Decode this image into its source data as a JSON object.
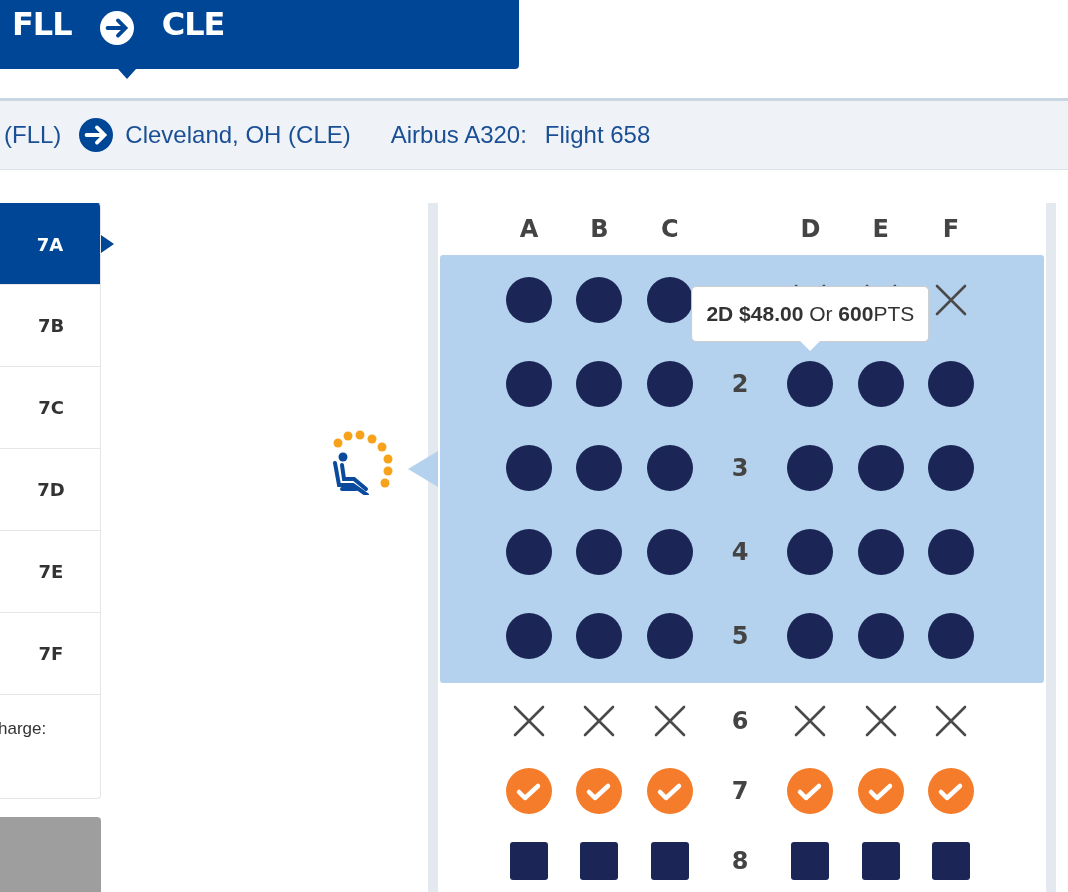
{
  "route_banner": {
    "origin": "FLL",
    "destination": "CLE"
  },
  "flight_bar": {
    "origin": "(FLL)",
    "destination": "Cleveland, OH (CLE)",
    "aircraft": "Airbus A320:",
    "flight": "Flight 658"
  },
  "seat_tabs": [
    {
      "label": "7A",
      "selected": true
    },
    {
      "label": "7B",
      "selected": false
    },
    {
      "label": "7C",
      "selected": false
    },
    {
      "label": "7D",
      "selected": false
    },
    {
      "label": "7E",
      "selected": false
    },
    {
      "label": "7F",
      "selected": false
    }
  ],
  "charge_note": "harge:",
  "seat_map": {
    "columns": [
      "A",
      "B",
      "C",
      "D",
      "E",
      "F"
    ],
    "zones": [
      {
        "kind": "highlighted",
        "rows": [
          {
            "seats": [
              {
                "kind": "available"
              },
              {
                "kind": "available"
              },
              {
                "kind": "available"
              },
              {
                "kind": "unavailable"
              },
              {
                "kind": "unavailable"
              },
              {
                "kind": "unavailable"
              }
            ]
          },
          {
            "number": "2",
            "seats": [
              {
                "kind": "available"
              },
              {
                "kind": "available"
              },
              {
                "kind": "available"
              },
              {
                "kind": "available",
                "tooltip": "**2D $48.00** Or **600**PTS"
              },
              {
                "kind": "available"
              },
              {
                "kind": "available"
              }
            ]
          },
          {
            "number": "3",
            "seats": [
              {
                "kind": "available"
              },
              {
                "kind": "available"
              },
              {
                "kind": "available"
              },
              {
                "kind": "available"
              },
              {
                "kind": "available"
              },
              {
                "kind": "available"
              }
            ]
          },
          {
            "number": "4",
            "seats": [
              {
                "kind": "available"
              },
              {
                "kind": "available"
              },
              {
                "kind": "available"
              },
              {
                "kind": "available"
              },
              {
                "kind": "available"
              },
              {
                "kind": "available"
              }
            ]
          },
          {
            "number": "5",
            "seats": [
              {
                "kind": "available"
              },
              {
                "kind": "available"
              },
              {
                "kind": "available"
              },
              {
                "kind": "available"
              },
              {
                "kind": "available"
              },
              {
                "kind": "available"
              }
            ]
          }
        ]
      },
      {
        "kind": "plain",
        "rows": [
          {
            "number": "6",
            "seats": [
              {
                "kind": "unavailable"
              },
              {
                "kind": "unavailable"
              },
              {
                "kind": "unavailable"
              },
              {
                "kind": "unavailable"
              },
              {
                "kind": "unavailable"
              },
              {
                "kind": "unavailable"
              }
            ]
          },
          {
            "number": "7",
            "seats": [
              {
                "kind": "selected"
              },
              {
                "kind": "selected"
              },
              {
                "kind": "selected"
              },
              {
                "kind": "selected"
              },
              {
                "kind": "selected"
              },
              {
                "kind": "selected"
              }
            ]
          },
          {
            "number": "8",
            "seats": [
              {
                "kind": "premium"
              },
              {
                "kind": "premium"
              },
              {
                "kind": "premium"
              },
              {
                "kind": "premium"
              },
              {
                "kind": "premium"
              },
              {
                "kind": "premium"
              }
            ]
          }
        ]
      }
    ]
  }
}
